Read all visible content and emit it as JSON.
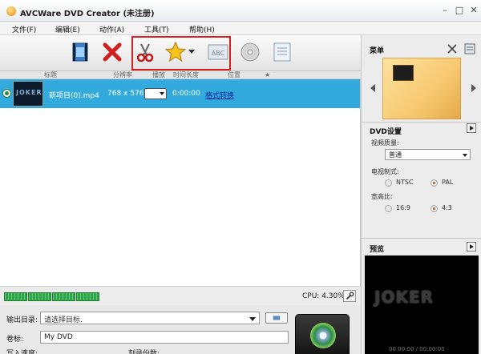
{
  "window": {
    "title": "AVCWare DVD Creator (未注册)"
  },
  "menu": [
    "文件(F)",
    "编辑(E)",
    "动作(A)",
    "工具(T)",
    "帮助(H)"
  ],
  "columns": {
    "title": "标题",
    "resolution": "分辨率",
    "subtitle": "播放",
    "duration": "时间长度",
    "position": "位置",
    "star": "★"
  },
  "file_row": {
    "name": "新项目(0).mp4",
    "resolution": "768 x 576",
    "duration": "0:00:00",
    "convert": "格式转换",
    "thumb_text": "JOKER"
  },
  "status": {
    "cpu": "CPU: 4.30%"
  },
  "output": {
    "label": "输出目录:",
    "placeholder": "请选择目标.",
    "volume_label": "卷标:",
    "volume_value": "My DVD",
    "write_speed": "写入速度:",
    "copies": "刻录份数:"
  },
  "right": {
    "menu_header": "菜单",
    "dvd_settings": "DVD设置",
    "video_quality_label": "视频质量:",
    "video_quality_value": "普通",
    "tv_standard_label": "电视制式:",
    "tv_options": [
      "NTSC",
      "PAL"
    ],
    "tv_selected": "PAL",
    "aspect_label": "宽高比:",
    "aspect_options": [
      "16:9",
      "4:3"
    ],
    "aspect_selected": "4:3",
    "preview_header": "预览",
    "preview_text": "JOKER",
    "preview_time": "00:00:00 / 00:00:00"
  },
  "colors": {
    "selection": "#33aadd",
    "highlight_box": "#d62020",
    "progress": "#2fa84a"
  }
}
